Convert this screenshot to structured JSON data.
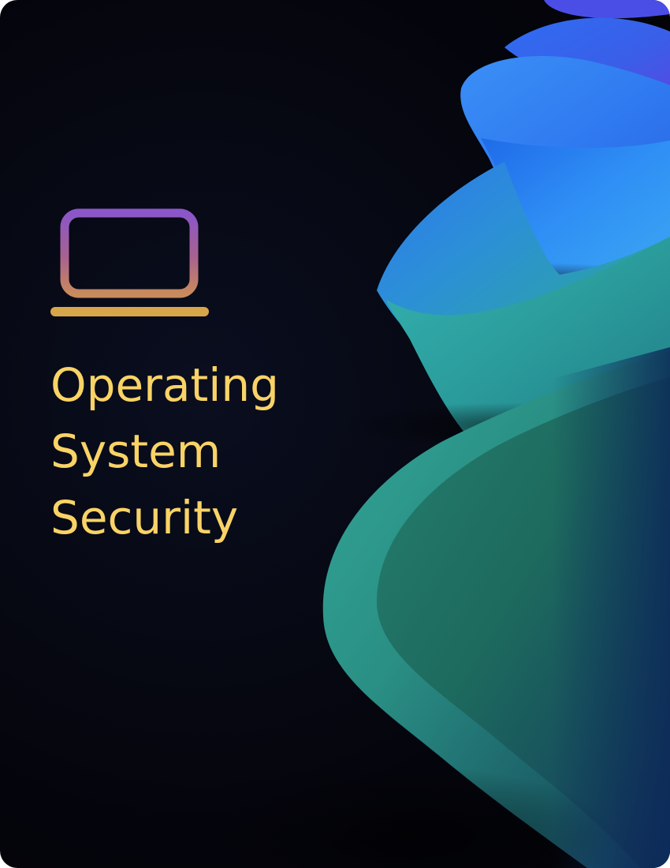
{
  "cover": {
    "title_lines": [
      "Operating",
      "System",
      "Security"
    ]
  },
  "icon": {
    "name": "laptop-icon",
    "gradient_top": "#8a56c9",
    "gradient_bottom": "#c98a5c",
    "base_color": "#d7a64a"
  },
  "colors": {
    "background": "#04050c",
    "title": "#f9d366",
    "bloom_blue": "#2f86f5",
    "bloom_teal": "#2aa39a",
    "bloom_green": "#1d6d5e"
  }
}
